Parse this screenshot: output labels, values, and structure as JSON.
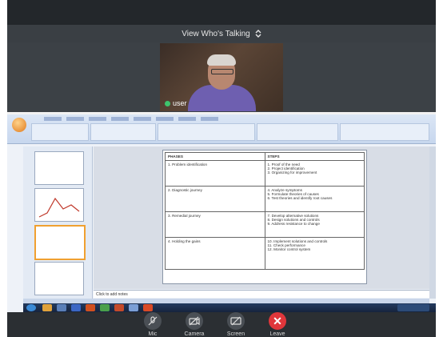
{
  "header": {
    "view_label": "View Who's Talking",
    "view_icon": "up-down-chevron-icon"
  },
  "participant": {
    "name": "user",
    "status_icon": "microphone-active-icon"
  },
  "slide": {
    "header_left": "PHASES",
    "header_right": "STEPS",
    "rows": [
      {
        "left": "1.  Problem identification",
        "right": [
          "1.    Proof of the need",
          "2.    Project identification",
          "3.    Organizing for improvement"
        ]
      },
      {
        "left": "2.  Diagnostic journey",
        "right": [
          "4.    Analyze symptoms",
          "5.    Formulate theories of causes",
          "6.    Test theories and identify root causes"
        ]
      },
      {
        "left": "3.  Remedial journey",
        "right": [
          "7.    Develop alternative solutions",
          "8.    Design solutions and controls",
          "9.    Address resistance to change"
        ]
      },
      {
        "left": "4.  Holding the gains",
        "right": [
          "10.   Implement solutions and controls",
          "11.   Check performance",
          "12.   Monitor control system"
        ]
      }
    ]
  },
  "notes_placeholder": "Click to add notes",
  "controls": [
    {
      "label": "Mic",
      "icon": "mic-off-icon"
    },
    {
      "label": "Camera",
      "icon": "camera-off-icon"
    },
    {
      "label": "Screen",
      "icon": "screen-share-off-icon"
    },
    {
      "label": "Leave",
      "icon": "close-icon"
    }
  ],
  "colors": {
    "leave": "#e0363b",
    "background": "#2b2f33",
    "mic_active": "#3ec46d"
  }
}
